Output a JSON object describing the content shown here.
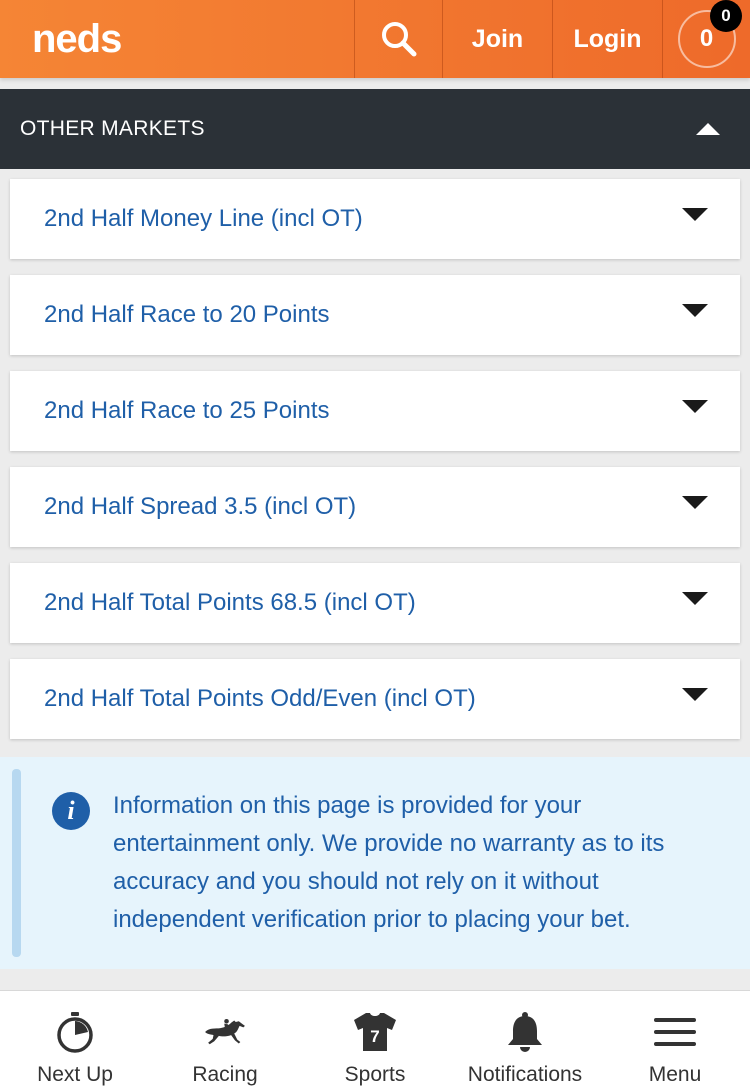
{
  "header": {
    "logo": "neds",
    "join_label": "Join",
    "login_label": "Login",
    "betslip_count": "0",
    "betslip_badge": "0",
    "icons": {
      "search": "search-icon"
    }
  },
  "section": {
    "title": "OTHER MARKETS",
    "toggle_icon": "chevron-up-icon"
  },
  "markets": [
    {
      "label": "2nd Half Money Line (incl OT)"
    },
    {
      "label": "2nd Half Race to 20 Points"
    },
    {
      "label": "2nd Half Race to 25 Points"
    },
    {
      "label": "2nd Half Spread 3.5 (incl OT)"
    },
    {
      "label": "2nd Half Total Points 68.5 (incl OT)"
    },
    {
      "label": "2nd Half Total Points Odd/Even (incl OT)"
    }
  ],
  "info": {
    "icon": "info-icon",
    "text": "Information on this page is provided for your entertainment only. We provide no warranty as to its accuracy and you should not rely on it without independent verification prior to placing your bet."
  },
  "bottom_nav": [
    {
      "label": "Next Up",
      "icon": "stopwatch-icon"
    },
    {
      "label": "Racing",
      "icon": "horse-icon"
    },
    {
      "label": "Sports",
      "icon": "jersey-icon"
    },
    {
      "label": "Notifications",
      "icon": "bell-icon"
    },
    {
      "label": "Menu",
      "icon": "hamburger-icon"
    }
  ],
  "colors": {
    "brand_orange": "#f07630",
    "dark_bar": "#2b3137",
    "link_blue": "#1f5fa8",
    "info_bg": "#e6f4fc"
  }
}
